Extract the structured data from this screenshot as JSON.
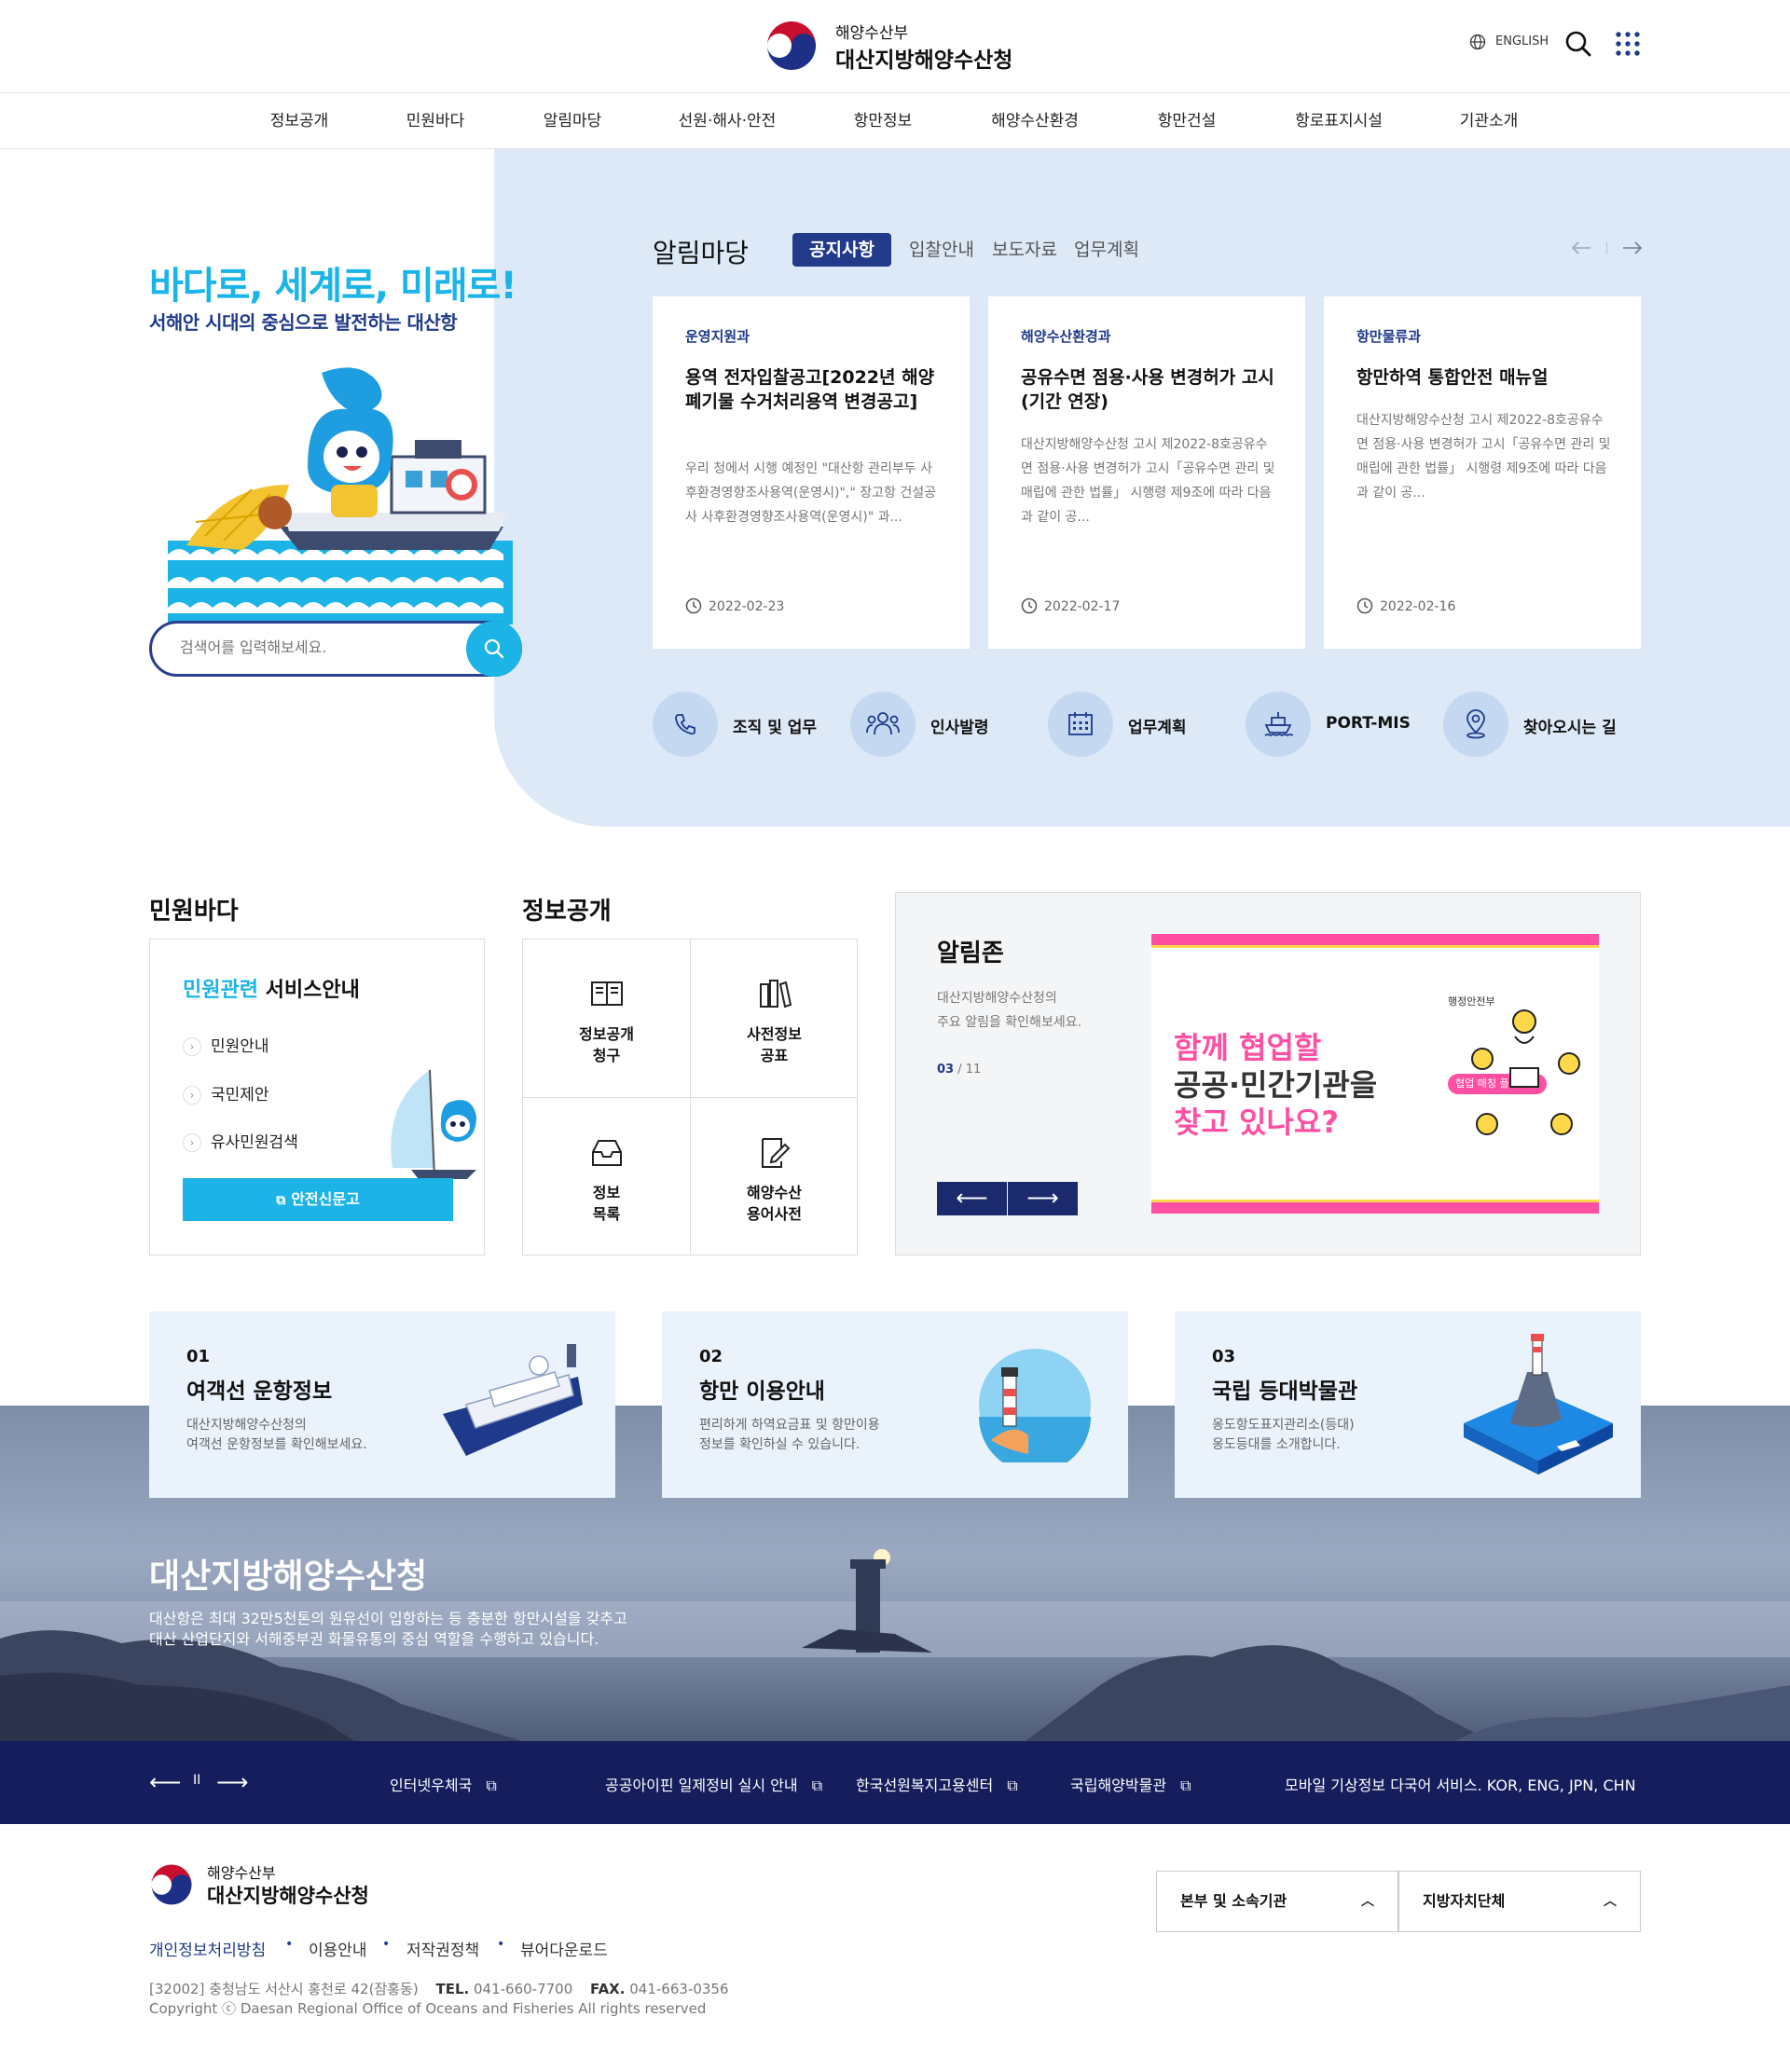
{
  "header": {
    "ministry": "해양수산부",
    "agency": "대산지방해양수산청",
    "language": "ENGLISH"
  },
  "nav": [
    "정보공개",
    "민원바다",
    "알림마당",
    "선원·해사·안전",
    "항만정보",
    "해양수산환경",
    "항만건설",
    "항로표지시설",
    "기관소개"
  ],
  "hero": {
    "slogan": "바다로, 세계로, 미래로!",
    "subslogan": "서해안 시대의 중심으로 발전하는 대산항",
    "search_placeholder": "검색어를 입력해보세요."
  },
  "notice": {
    "title": "알림마당",
    "tabs": [
      "공지사항",
      "입찰안내",
      "보도자료",
      "업무계획"
    ],
    "cards": [
      {
        "dept": "운영지원과",
        "title": "용역 전자입찰공고[2022년 해양폐기물 수거처리용역 변경공고]",
        "desc": "우리 청에서 시행 예정인 \"대산항 관리부두 사후환경영향조사용역(운영시)\",\" 장고항 건설공사 사후환경영향조사용역(운영시)\" 과...",
        "date": "2022-02-23"
      },
      {
        "dept": "해양수산환경과",
        "title": "공유수면 점용·사용 변경허가 고시(기간 연장)",
        "desc": "대산지방해양수산청 고시 제2022-8호공유수면 점용·사용 변경허가 고시「공유수면 관리 및 매립에 관한 법률」 시행령 제9조에 따라 다음과 같이 공...",
        "date": "2022-02-17"
      },
      {
        "dept": "항만물류과",
        "title": "항만하역 통합안전 매뉴얼",
        "desc": "대산지방해양수산청 고시 제2022-8호공유수면 점용·사용 변경허가 고시「공유수면 관리 및 매립에 관한 법률」 시행령 제9조에 따라 다음과 같이 공...",
        "date": "2022-02-16"
      }
    ]
  },
  "quicklinks": [
    {
      "label": "조직 및 업무",
      "icon": "phone-icon"
    },
    {
      "label": "인사발령",
      "icon": "people-icon"
    },
    {
      "label": "업무계획",
      "icon": "calendar-icon"
    },
    {
      "label": "PORT-MIS",
      "icon": "ship-icon"
    },
    {
      "label": "찾아오시는 길",
      "icon": "location-icon"
    }
  ],
  "civil": {
    "section_title": "민원바다",
    "box_title_accent": "민원관련",
    "box_title": "서비스안내",
    "items": [
      "민원안내",
      "국민제안",
      "유사민원검색"
    ],
    "button": "안전신문고"
  },
  "info": {
    "section_title": "정보공개",
    "cells": [
      {
        "line1": "정보공개",
        "line2": "청구",
        "icon": "book-icon"
      },
      {
        "line1": "사전정보",
        "line2": "공표",
        "icon": "files-icon"
      },
      {
        "line1": "정보",
        "line2": "목록",
        "icon": "inbox-icon"
      },
      {
        "line1": "해양수산",
        "line2": "용어사전",
        "icon": "edit-icon"
      }
    ]
  },
  "alimzone": {
    "title": "알림존",
    "desc1": "대산지방해양수산청의",
    "desc2": "주요 알림을 확인해보세요.",
    "page_current": "03",
    "page_total": "/ 11",
    "promo": {
      "line1": "함께 협업할",
      "line2": "공공·민간기관을",
      "line3": "찾고 있나요?",
      "badge": "협업 매칭 플랫폼",
      "org": "행정안전부"
    }
  },
  "banners": [
    {
      "num": "01",
      "title": "여객선 운항정보",
      "desc1": "대산지방해양수산청의",
      "desc2": "여객선 운항정보를 확인해보세요."
    },
    {
      "num": "02",
      "title": "항만 이용안내",
      "desc1": "편리하게 하역요금표 및 항만이용",
      "desc2": "정보를 확인하실 수 있습니다."
    },
    {
      "num": "03",
      "title": "국립 등대박물관",
      "desc1": "옹도항도표지관리소(등대)",
      "desc2": "옹도등대를 소개합니다."
    }
  ],
  "sea": {
    "title": "대산지방해양수산청",
    "desc1": "대산항은 최대 32만5천톤의 원유선이 입항하는 등 충분한 항만시설을 갖추고",
    "desc2": "대산 산업단지와 서해중부권 화물유통의 중심 역할을 수행하고 있습니다."
  },
  "linkbar": [
    "인터넷우체국",
    "공공아이핀 일제정비 실시 안내",
    "한국선원복지고용센터",
    "국립해양박물관",
    "모바일 기상정보 다국어 서비스. KOR, ENG, JPN, CHN"
  ],
  "footer": {
    "ministry": "해양수산부",
    "agency": "대산지방해양수산청",
    "links": [
      "개인정보처리방침",
      "이용안내",
      "저작권정책",
      "뷰어다운로드"
    ],
    "address": "[32002] 충청남도 서산시 홍천로 42(잠홍동)",
    "tel_label": "TEL.",
    "tel": "041-660-7700",
    "fax_label": "FAX.",
    "fax": "041-663-0356",
    "copyright": "Copyright ⓒ Daesan Regional Office of Oceans and Fisheries All rights reserved",
    "select1": "본부 및 소속기관",
    "select2": "지방자치단체"
  },
  "colors": {
    "primary": "#1f3a8a",
    "accent": "#1cb3e6",
    "hero_bg": "#dde9f7",
    "linkbar": "#151d5c",
    "promo_pink": "#ff4fa3"
  }
}
